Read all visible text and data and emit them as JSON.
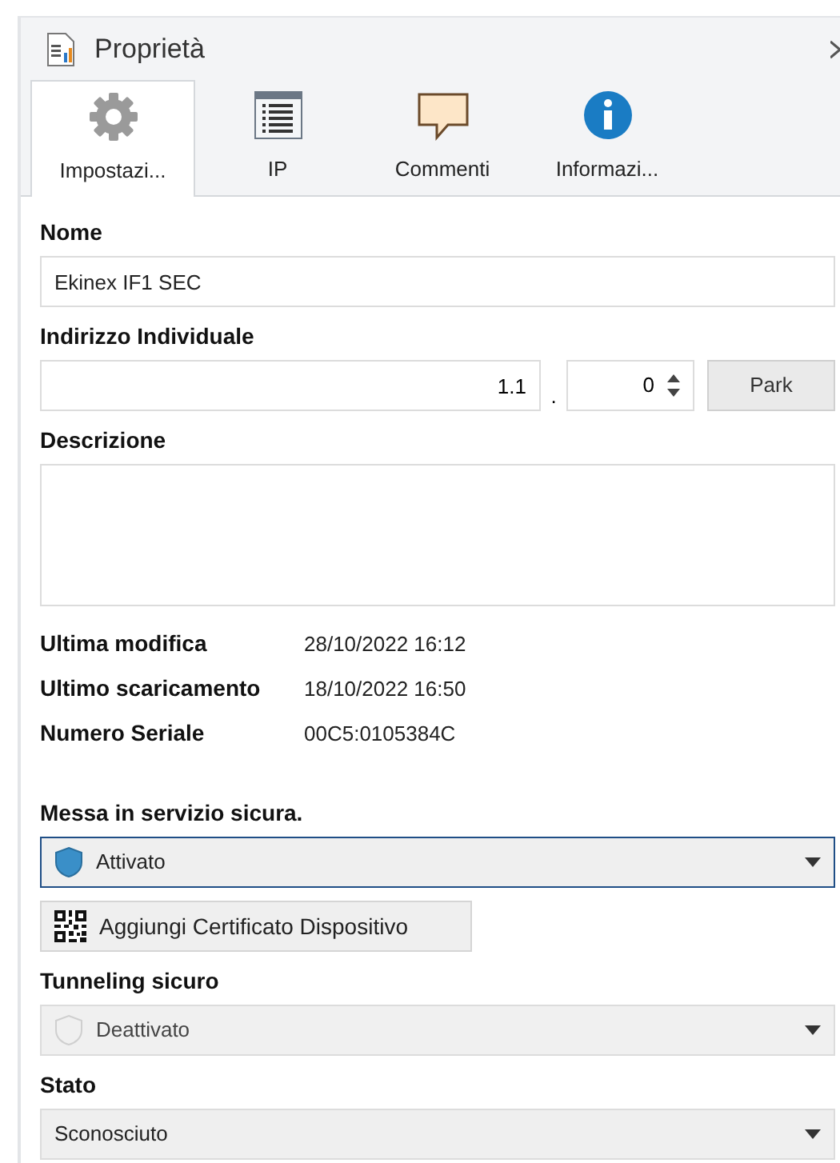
{
  "panel": {
    "title": "Proprietà"
  },
  "tabs": [
    {
      "label": "Impostazi...",
      "kind": "gear",
      "selected": true
    },
    {
      "label": "IP",
      "kind": "list",
      "selected": false
    },
    {
      "label": "Commenti",
      "kind": "comment",
      "selected": false
    },
    {
      "label": "Informazi...",
      "kind": "info",
      "selected": false
    }
  ],
  "name_field": {
    "label": "Nome",
    "value": "Ekinex IF1 SEC"
  },
  "address": {
    "label": "Indirizzo Individuale",
    "value": "1.1",
    "separator": ".",
    "spin_value": "0",
    "park_button": "Park"
  },
  "description": {
    "label": "Descrizione"
  },
  "info_rows": [
    {
      "label": "Ultima modifica",
      "value": "28/10/2022 16:12"
    },
    {
      "label": "Ultimo scaricamento",
      "value": "18/10/2022 16:50"
    },
    {
      "label": "Numero Seriale",
      "value": "00C5:0105384C"
    }
  ],
  "secure_commissioning": {
    "label": "Messa in servizio sicura.",
    "value": "Attivato",
    "shield": true,
    "focused": true,
    "disabled": false,
    "button": "Aggiungi Certificato Dispositivo"
  },
  "secure_tunneling": {
    "label": "Tunneling sicuro",
    "value": "Deattivato",
    "shield": true,
    "focused": false,
    "disabled": true
  },
  "state": {
    "label": "Stato",
    "value": "Sconosciuto",
    "shield": false,
    "focused": false,
    "disabled": false
  }
}
